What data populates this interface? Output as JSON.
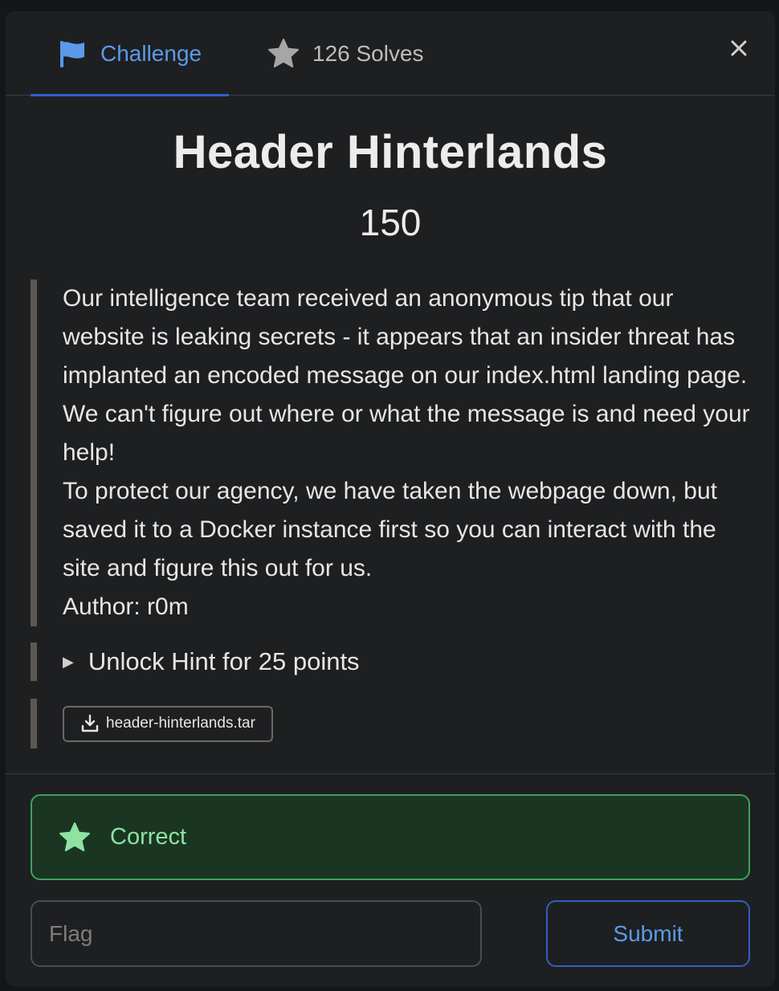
{
  "tabs": {
    "challenge": {
      "label": "Challenge",
      "icon": "flag-icon",
      "active": true
    },
    "solves": {
      "label": "126 Solves",
      "icon": "star-icon"
    }
  },
  "close_icon": "close-icon",
  "challenge": {
    "title": "Header Hinterlands",
    "points": "150",
    "description": [
      "Our intelligence team received an anonymous tip that our website is leaking secrets - it appears that an insider threat has implanted an encoded message on our index.html landing page. We can't figure out where or what the message is and need your help!",
      "To protect our agency, we have taken the webpage down, but saved it to a Docker instance first so you can interact with the site and figure this out for us.",
      "Author: r0m"
    ],
    "hint": {
      "label": "Unlock Hint for 25 points"
    },
    "file": {
      "name": "header-hinterlands.tar",
      "icon": "download-icon"
    }
  },
  "alert": {
    "label": "Correct",
    "icon": "star-icon",
    "color": "#3fa25a"
  },
  "flag": {
    "placeholder": "Flag",
    "value": ""
  },
  "submit": {
    "label": "Submit"
  },
  "colors": {
    "accent": "#5b9aea",
    "success": "#8ee2a2",
    "background": "#1e1f21"
  }
}
